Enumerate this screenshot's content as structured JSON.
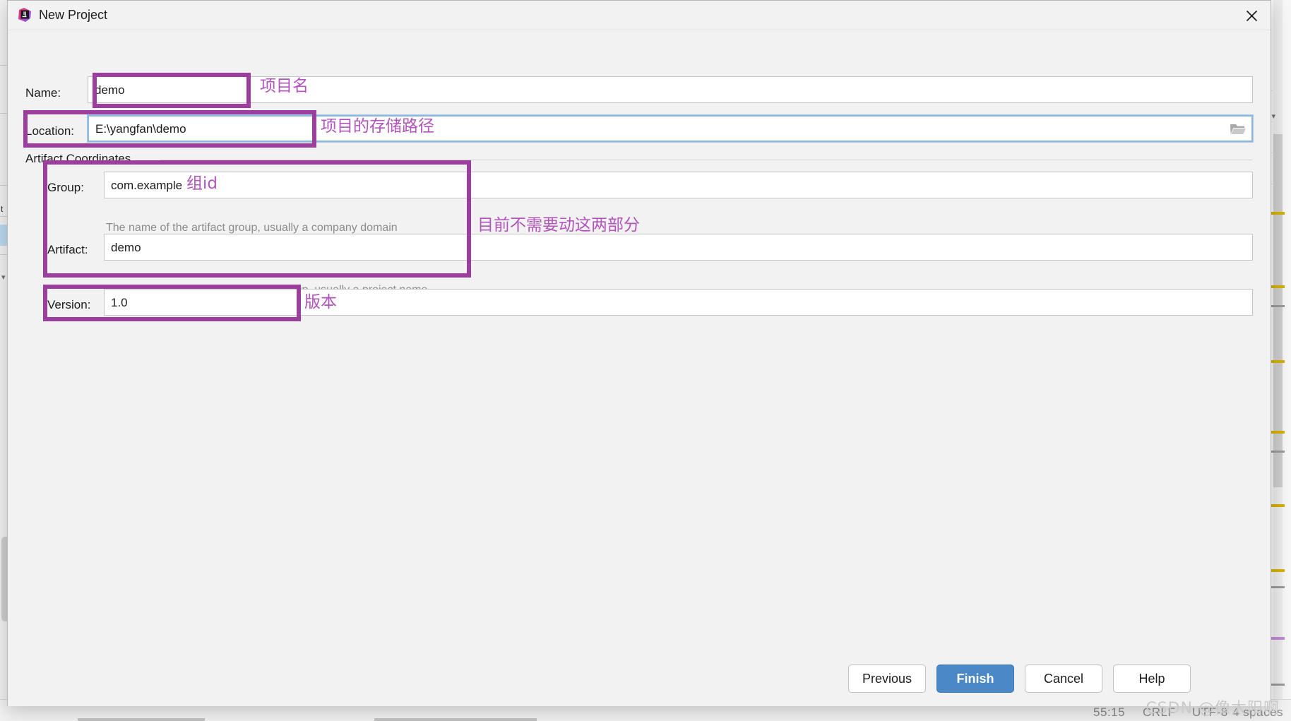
{
  "window": {
    "title": "New Project",
    "icon": "intellij-idea-logo",
    "close_icon": "close-icon"
  },
  "form": {
    "name": {
      "label": "Name:",
      "value": "demo"
    },
    "location": {
      "label": "Location:",
      "value": "E:\\yangfan\\demo",
      "browse_icon": "folder-open-icon"
    },
    "group_section": {
      "title": "Artifact Coordinates"
    },
    "group": {
      "label": "Group:",
      "value": "com.example",
      "hint": "The name of the artifact group, usually a company domain"
    },
    "artifact": {
      "label": "Artifact:",
      "value": "demo",
      "hint": "The name of the artifact within the group, usually a project name"
    },
    "version": {
      "label": "Version:",
      "value": "1.0"
    }
  },
  "annotations": {
    "accent_color": "#9b3e9e",
    "text_color": "#b154bb",
    "name": "项目名",
    "location": "项目的存储路径",
    "group": "组id",
    "coordinates": "目前不需要动这两部分",
    "version": "版本"
  },
  "footer": {
    "previous": "Previous",
    "finish": "Finish",
    "cancel": "Cancel",
    "help": "Help",
    "primary_color": "#4a88c7"
  },
  "background": {
    "status_left": "55:15",
    "status_mid": "CRLF",
    "status_enc": "UTF-8",
    "status_indent": "4 spaces"
  },
  "watermark": {
    "text": "CSDN @像太阳啊"
  }
}
